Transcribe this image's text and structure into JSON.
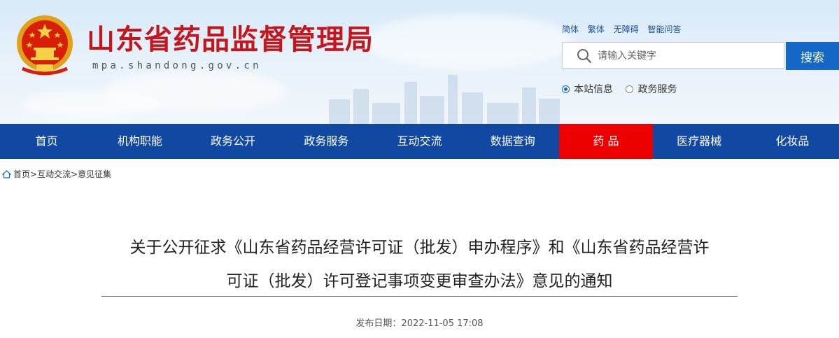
{
  "header": {
    "site_title": "山东省药品监督管理局",
    "domain": "mpa.shandong.gov.cn",
    "top_links": [
      "简体",
      "繁体",
      "无障碍",
      "智能问答"
    ],
    "search": {
      "placeholder": "请输入关键字",
      "button_label": "搜索"
    },
    "scope_options": [
      {
        "label": "本站信息",
        "checked": true
      },
      {
        "label": "政务服务",
        "checked": false
      }
    ],
    "emblem_icon": "national-emblem-icon",
    "title_color": "#c4161c"
  },
  "nav": {
    "items": [
      "首页",
      "机构职能",
      "政务公开",
      "政务服务",
      "互动交流",
      "数据查询",
      "药 品",
      "医疗器械",
      "化妆品"
    ],
    "active": "药 品",
    "background": "#1148a1",
    "active_color": "#ee0000"
  },
  "breadcrumb": {
    "icon": "home-icon",
    "items": [
      "首页",
      "互动交流",
      "意见征集"
    ],
    "separator": ">"
  },
  "article": {
    "title_line1": "关于公开征求《山东省药品经营许可证（批发）申办程序》和《山东省药品经营许",
    "title_line2": "可证（批发）许可登记事项变更审查办法》意见的通知",
    "publish_date_label": "发布日期：",
    "publish_date": "2022-11-05 17:08"
  }
}
